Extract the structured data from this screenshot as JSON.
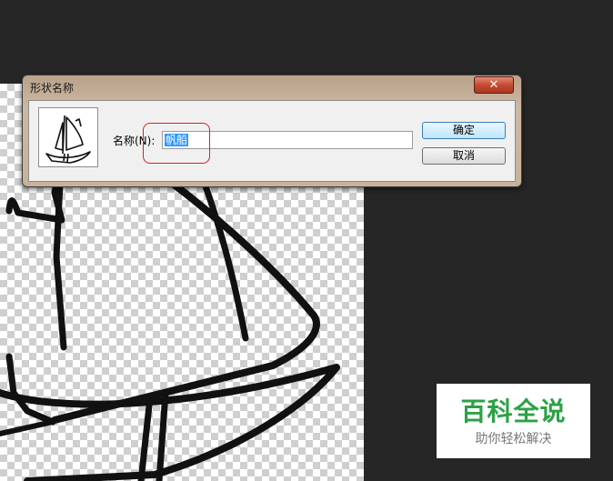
{
  "dialog": {
    "title": "形状名称",
    "close_icon": "close-icon",
    "name_label": "名称(N):",
    "name_value": "帆船",
    "ok_label": "确定",
    "cancel_label": "取消",
    "preview_icon": "sailboat-icon"
  },
  "watermark": {
    "title": "百科全说",
    "subtitle": "助你轻松解决"
  },
  "colors": {
    "workspace": "#262626",
    "highlight_box": "#d6231f",
    "selection": "#3399ff",
    "watermark_green": "#2ba245"
  }
}
